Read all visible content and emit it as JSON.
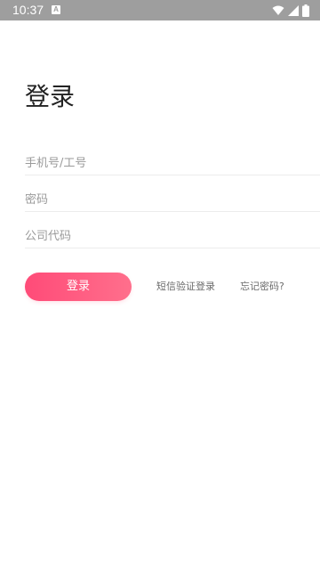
{
  "status_bar": {
    "time": "10:37",
    "notification_icon": "a-app-icon",
    "icons": [
      "wifi-icon",
      "signal-icon",
      "battery-icon"
    ]
  },
  "page": {
    "title": "登录"
  },
  "form": {
    "phone_placeholder": "手机号/工号",
    "phone_value": "",
    "password_placeholder": "密码",
    "password_value": "",
    "company_placeholder": "公司代码",
    "company_value": ""
  },
  "actions": {
    "login_label": "登录",
    "sms_login_label": "短信验证登录",
    "forgot_password_label": "忘记密码?"
  },
  "colors": {
    "status_bar": "#9e9e9e",
    "accent_start": "#ff4b78",
    "accent_end": "#ff6f8c",
    "background": "#ffffff"
  }
}
